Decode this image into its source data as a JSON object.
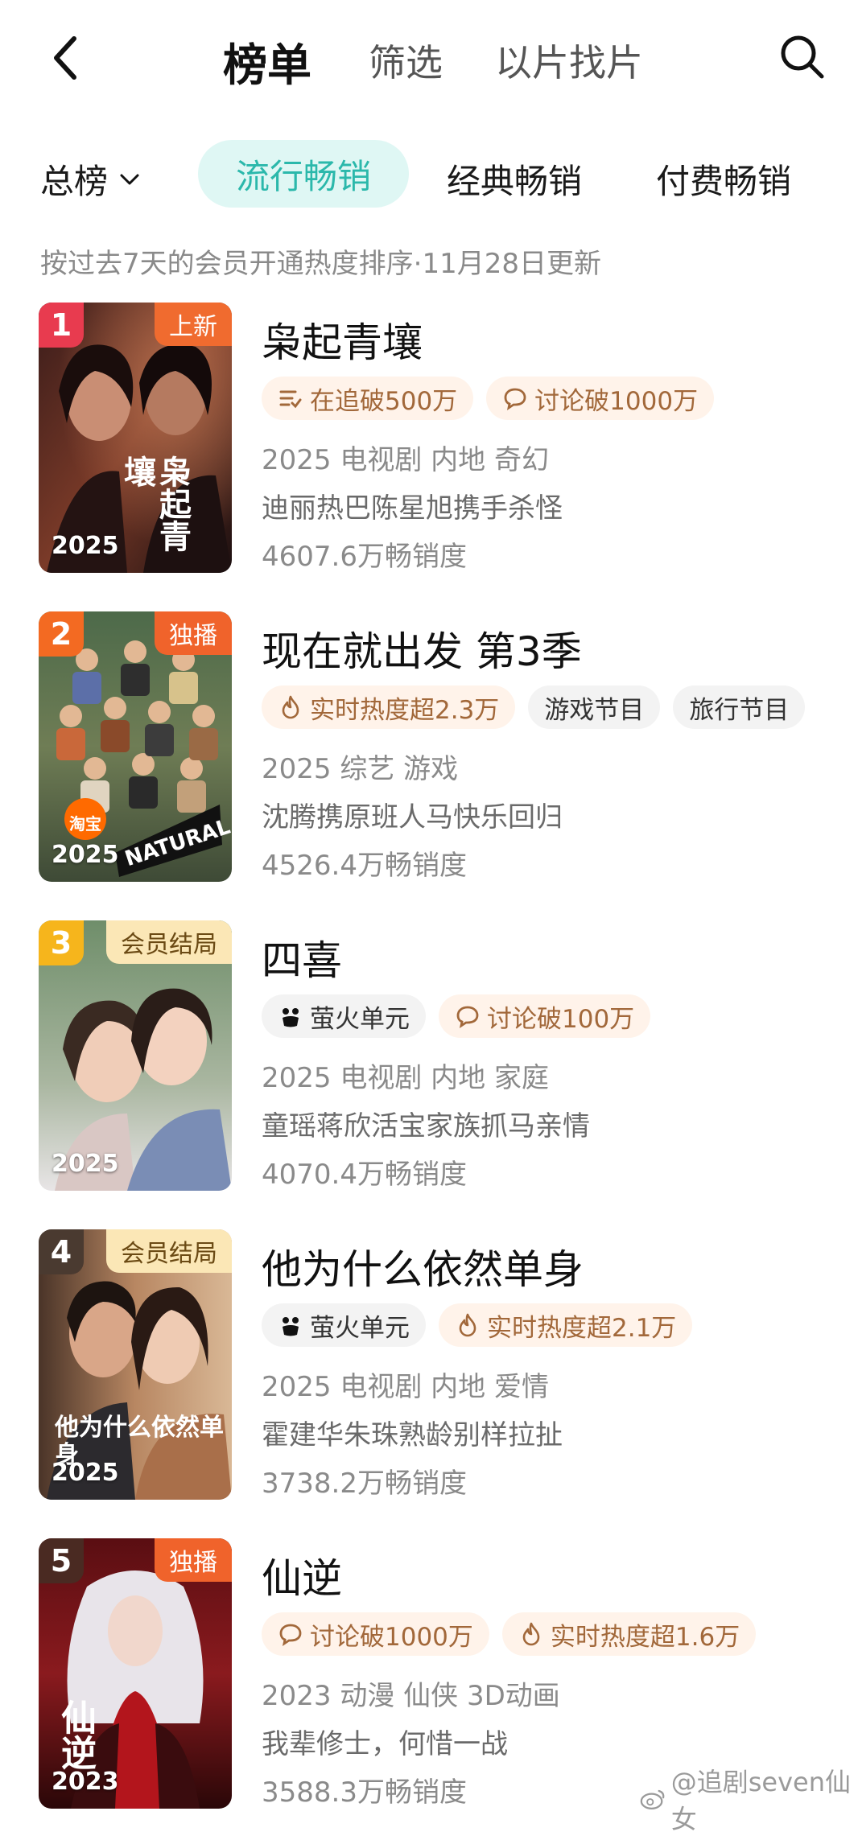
{
  "header": {
    "title": "榜单",
    "filter": "筛选",
    "image_search": "以片找片"
  },
  "tabs": {
    "total": "总榜",
    "items": [
      "流行畅销",
      "经典畅销",
      "付费畅销"
    ],
    "active": 0
  },
  "subnote": "按过去7天的会员开通热度排序·11月28日更新",
  "colors": {
    "accent": "#2bb8ab",
    "rank1": "#e83b4f",
    "rank2": "#f36a22",
    "rank3": "#f6b51c",
    "rank_other": "#4a3a30",
    "new_badge": "#f06b2f",
    "exclusive_badge": "#f0632b"
  },
  "items": [
    {
      "rank": "1",
      "badge": "上新",
      "badge_type": "new",
      "year": "2025",
      "poster_text": "枭起青壤",
      "title": "枭起青壤",
      "tags": [
        {
          "icon": "list-icon",
          "text": "在追破500万"
        },
        {
          "icon": "comment-icon",
          "text": "讨论破1000万"
        }
      ],
      "info": "2025 电视剧 内地 奇幻",
      "desc": "迪丽热巴陈星旭携手杀怪",
      "sales": "4607.6万畅销度"
    },
    {
      "rank": "2",
      "badge": "独播",
      "badge_type": "exclusive",
      "year": "2025",
      "poster_text": "淘宝",
      "title": "现在就出发 第3季",
      "tags": [
        {
          "icon": "flame-icon",
          "text": "实时热度超2.3万"
        },
        {
          "icon": "",
          "text": "游戏节目"
        },
        {
          "icon": "",
          "text": "旅行节目"
        }
      ],
      "info": "2025 综艺 游戏",
      "desc": "沈腾携原班人马快乐回归",
      "sales": "4526.4万畅销度"
    },
    {
      "rank": "3",
      "badge": "会员结局",
      "badge_type": "member",
      "year": "2025",
      "poster_text": "",
      "title": "四喜",
      "tags": [
        {
          "icon": "firefly-icon",
          "text": "萤火单元"
        },
        {
          "icon": "comment-icon",
          "text": "讨论破100万"
        }
      ],
      "info": "2025 电视剧 内地 家庭",
      "desc": "童瑶蒋欣活宝家族抓马亲情",
      "sales": "4070.4万畅销度"
    },
    {
      "rank": "4",
      "badge": "会员结局",
      "badge_type": "member",
      "year": "2025",
      "poster_text": "他为什么依然单身",
      "title": "他为什么依然单身",
      "tags": [
        {
          "icon": "firefly-icon",
          "text": "萤火单元"
        },
        {
          "icon": "flame-icon",
          "text": "实时热度超2.1万"
        }
      ],
      "info": "2025 电视剧 内地 爱情",
      "desc": "霍建华朱珠熟龄别样拉扯",
      "sales": "3738.2万畅销度"
    },
    {
      "rank": "5",
      "badge": "独播",
      "badge_type": "exclusive",
      "year": "2023",
      "poster_text": "仙逆",
      "title": "仙逆",
      "tags": [
        {
          "icon": "comment-icon",
          "text": "讨论破1000万"
        },
        {
          "icon": "flame-icon",
          "text": "实时热度超1.6万"
        }
      ],
      "info": "2023 动漫 仙侠 3D动画",
      "desc": "我辈修士，何惜一战",
      "sales": "3588.3万畅销度"
    }
  ],
  "watermark": "@追剧seven仙女"
}
